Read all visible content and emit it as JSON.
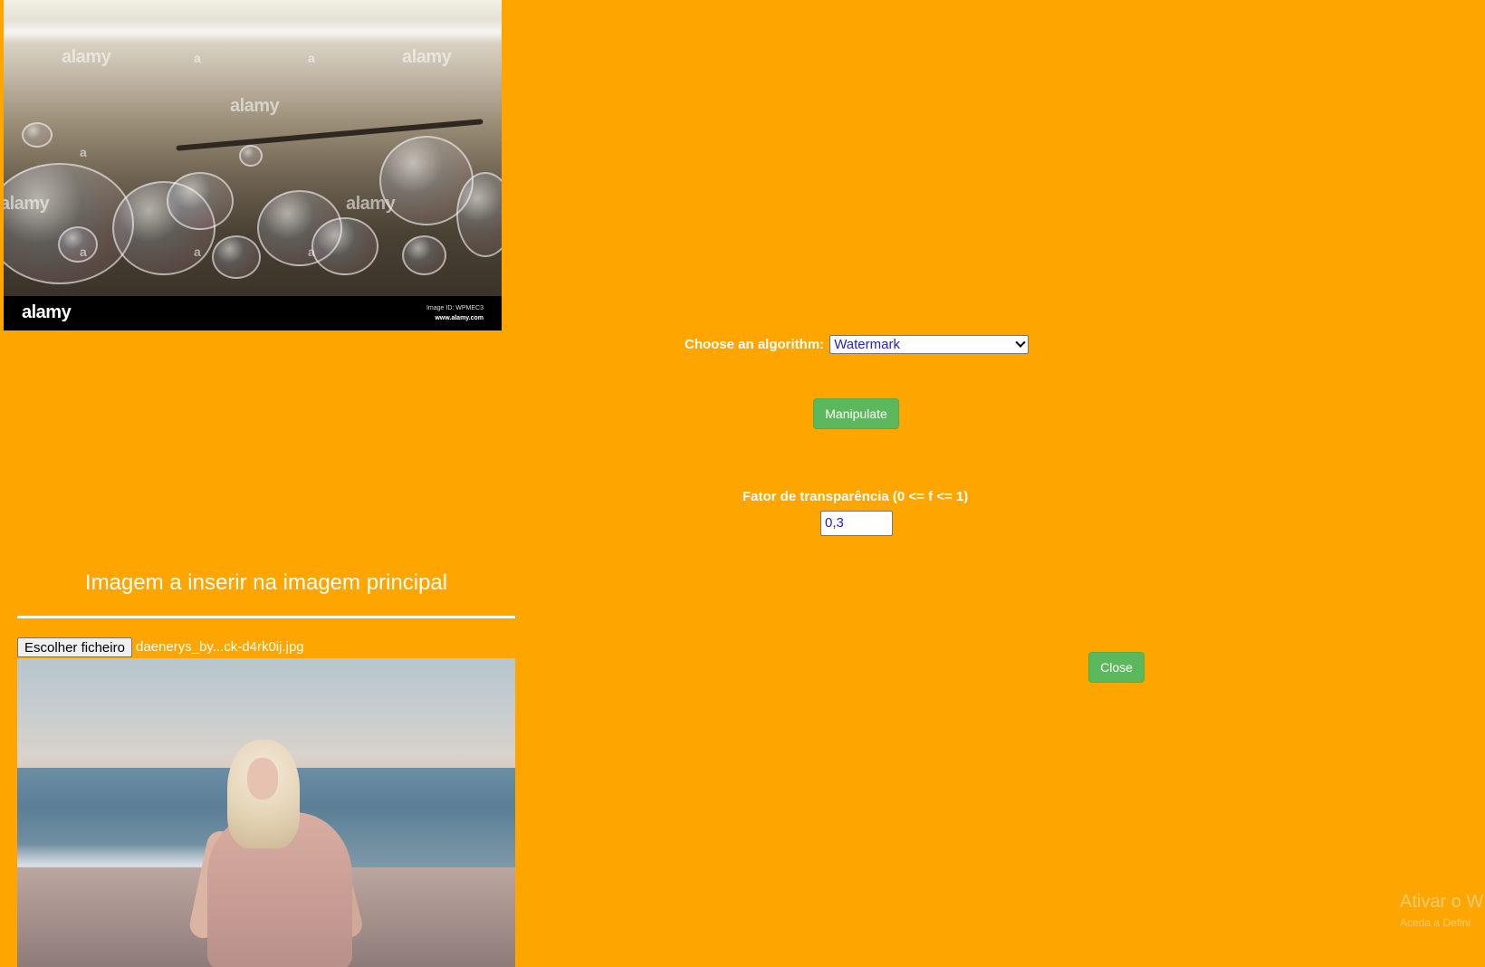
{
  "main_image": {
    "watermark_text": "alamy",
    "small_watermark_text": "a",
    "stock_bar": {
      "logo": "alamy",
      "image_id": "Image ID: WPMEC3",
      "url": "www.alamy.com"
    }
  },
  "controls": {
    "algorithm_label": "Choose an algorithm:",
    "algorithm_selected": "Watermark",
    "manipulate_label": "Manipulate",
    "transparency_label": "Fator de transparência (0 <= f <= 1)",
    "transparency_value": "0,3",
    "close_label": "Close"
  },
  "insert_section": {
    "title": "Imagem a inserir na imagem principal",
    "file_button_label": "Escolher ficheiro",
    "file_name": "daenerys_by...ck-d4rk0ij.jpg"
  },
  "system_overlay": {
    "activate_text": "Ativar o W",
    "activate_sub": "Aceda a Defini"
  },
  "colors": {
    "background": "#ffa500",
    "button_green": "#5cb85c",
    "text_white": "#ffffff",
    "select_text": "#2222cc"
  }
}
